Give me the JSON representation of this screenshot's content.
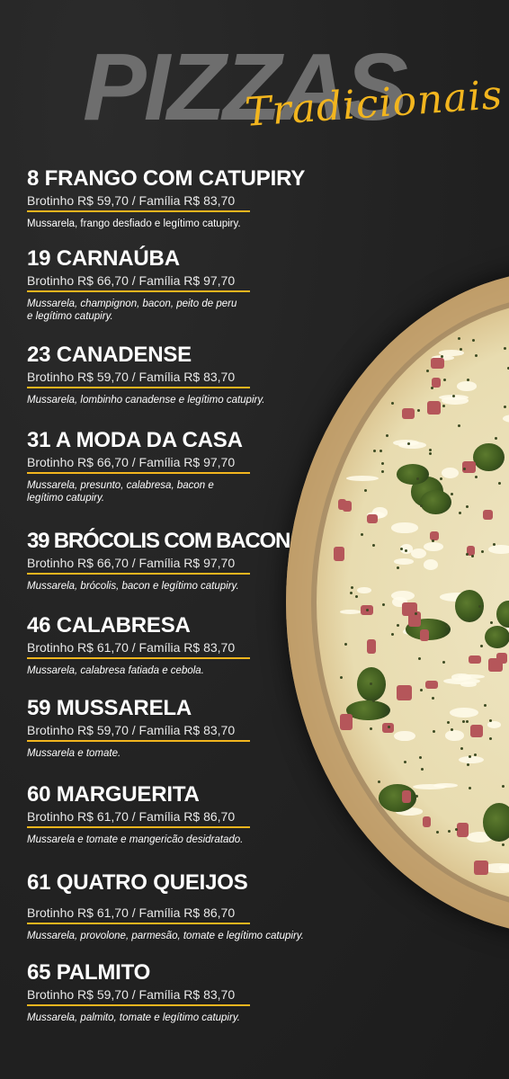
{
  "header": {
    "title": "PIZZAS",
    "subtitle": "Tradicionais"
  },
  "colors": {
    "accent": "#f2b51e",
    "background": "#232323",
    "title_gray": "#6e6e6e"
  },
  "items": [
    {
      "name": "8  FRANGO COM CATUPIRY",
      "price": "Brotinho R$ 59,70 / Família R$ 83,70",
      "desc": "Mussarela, frango desfiado e legítimo catupiry."
    },
    {
      "name": "19 CARNAÚBA",
      "price": "Brotinho R$ 66,70 / Família R$ 97,70",
      "desc": "Mussarela, champignon, bacon, peito de peru\ne legítimo catupiry."
    },
    {
      "name": "23 CANADENSE",
      "price": "Brotinho R$ 59,70 / Família R$ 83,70",
      "desc": "Mussarela, lombinho canadense e legítimo catupiry."
    },
    {
      "name": "31 A MODA DA CASA",
      "price": "Brotinho R$ 66,70 / Família R$ 97,70",
      "desc": "Mussarela, presunto, calabresa, bacon e\nlegítimo catupiry."
    },
    {
      "name": "39 BRÓCOLIS COM BACON",
      "price": "Brotinho R$ 66,70 / Família R$ 97,70",
      "desc": "Mussarela, brócolis, bacon e legítimo catupiry."
    },
    {
      "name": "46 CALABRESA",
      "price": "Brotinho R$ 61,70 / Família R$ 83,70",
      "desc": "Mussarela, calabresa fatiada e cebola."
    },
    {
      "name": "59 MUSSARELA",
      "price": "Brotinho R$ 59,70 / Família R$ 83,70",
      "desc": "Mussarela e tomate."
    },
    {
      "name": "60 MARGUERITA",
      "price": "Brotinho R$ 61,70 / Família R$ 86,70",
      "desc": "Mussarela e tomate e mangericão desidratado."
    },
    {
      "name": "61 QUATRO QUEIJOS",
      "price": "Brotinho R$ 61,70 / Família R$ 86,70",
      "desc": "Mussarela, provolone, parmesão, tomate e legítimo catupiry."
    },
    {
      "name": "65 PALMITO",
      "price": "Brotinho R$ 59,70 / Família R$ 83,70",
      "desc": "Mussarela, palmito, tomate e legítimo catupiry."
    }
  ]
}
